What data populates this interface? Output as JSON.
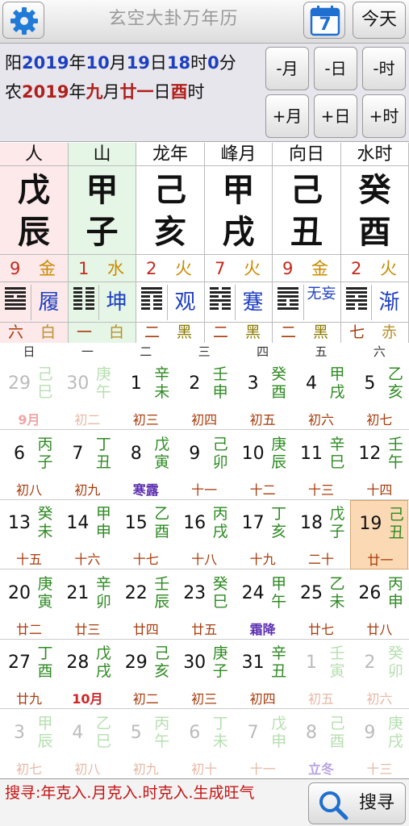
{
  "app": {
    "title": "玄空大卦万年历",
    "calendar_icon_day": "7",
    "today_label": "今天"
  },
  "date": {
    "solar_prefix": "阳",
    "solar_year": "2019",
    "year_char": "年",
    "solar_month": "10",
    "month_char": "月",
    "solar_day": "19",
    "day_char": "日",
    "solar_hour": "18",
    "hour_char": "时",
    "solar_min": "0",
    "min_char": "分",
    "lunar_prefix": "农",
    "lunar_year": "2019",
    "lunar_month": "九",
    "lunar_day": "廿一",
    "lunar_hour": "酉"
  },
  "nav": {
    "minus_month": "-月",
    "minus_day": "-日",
    "minus_hour": "-时",
    "plus_month": "+月",
    "plus_day": "+日",
    "plus_hour": "+时"
  },
  "pillars": [
    {
      "head": "人",
      "stem": "戊",
      "branch": "辰",
      "num": "9",
      "elem": "金",
      "elem_color": "#c98a00",
      "hex": "履",
      "hex_lines": [
        1,
        1,
        0,
        1,
        1,
        1
      ],
      "star_num": "六",
      "star": "白",
      "star_color": "#b8902a",
      "bg": "#fde8ea"
    },
    {
      "head": "山",
      "stem": "甲",
      "branch": "子",
      "num": "1",
      "elem": "水",
      "elem_color": "#c98a00",
      "hex": "坤",
      "hex_lines": [
        0,
        0,
        0,
        0,
        0,
        0
      ],
      "star_num": "一",
      "star": "白",
      "star_color": "#b8902a",
      "bg": "#e6f6e6"
    },
    {
      "head": "龙年",
      "stem": "己",
      "branch": "亥",
      "num": "2",
      "elem": "火",
      "elem_color": "#c98a00",
      "hex": "观",
      "hex_lines": [
        1,
        1,
        0,
        0,
        0,
        0
      ],
      "star_num": "二",
      "star": "黑",
      "star_color": "#8a7a00",
      "bg": "#fff"
    },
    {
      "head": "峰月",
      "stem": "甲",
      "branch": "戌",
      "num": "7",
      "elem": "火",
      "elem_color": "#c98a00",
      "hex": "蹇",
      "hex_lines": [
        0,
        1,
        0,
        1,
        0,
        0
      ],
      "star_num": "二",
      "star": "黑",
      "star_color": "#8a7a00",
      "bg": "#fff"
    },
    {
      "head": "向日",
      "stem": "己",
      "branch": "丑",
      "num": "9",
      "elem": "金",
      "elem_color": "#c98a00",
      "hex": "无妄",
      "hex_lines": [
        1,
        1,
        1,
        0,
        0,
        1
      ],
      "star_num": "二",
      "star": "黑",
      "star_color": "#8a7a00",
      "bg": "#fff"
    },
    {
      "head": "水时",
      "stem": "癸",
      "branch": "酉",
      "num": "2",
      "elem": "火",
      "elem_color": "#c98a00",
      "hex": "渐",
      "hex_lines": [
        1,
        1,
        0,
        1,
        0,
        0
      ],
      "star_num": "七",
      "star": "赤",
      "star_color": "#b8902a",
      "bg": "#fff"
    }
  ],
  "weekdays": [
    "日",
    "一",
    "二",
    "三",
    "四",
    "五",
    "六"
  ],
  "calendar": [
    [
      {
        "d": "29",
        "gz": [
          "己",
          "巳"
        ],
        "lu": "9月",
        "dim": true,
        "type": "month"
      },
      {
        "d": "30",
        "gz": [
          "庚",
          "午"
        ],
        "lu": "初二",
        "dim": true
      },
      {
        "d": "1",
        "gz": [
          "辛",
          "未"
        ],
        "lu": "初三"
      },
      {
        "d": "2",
        "gz": [
          "壬",
          "申"
        ],
        "lu": "初四"
      },
      {
        "d": "3",
        "gz": [
          "癸",
          "酉"
        ],
        "lu": "初五"
      },
      {
        "d": "4",
        "gz": [
          "甲",
          "戌"
        ],
        "lu": "初六"
      },
      {
        "d": "5",
        "gz": [
          "乙",
          "亥"
        ],
        "lu": "初七"
      }
    ],
    [
      {
        "d": "6",
        "gz": [
          "丙",
          "子"
        ],
        "lu": "初八"
      },
      {
        "d": "7",
        "gz": [
          "丁",
          "丑"
        ],
        "lu": "初九"
      },
      {
        "d": "8",
        "gz": [
          "戊",
          "寅"
        ],
        "lu": "寒露",
        "type": "term"
      },
      {
        "d": "9",
        "gz": [
          "己",
          "卯"
        ],
        "lu": "十一"
      },
      {
        "d": "10",
        "gz": [
          "庚",
          "辰"
        ],
        "lu": "十二"
      },
      {
        "d": "11",
        "gz": [
          "辛",
          "巳"
        ],
        "lu": "十三"
      },
      {
        "d": "12",
        "gz": [
          "壬",
          "午"
        ],
        "lu": "十四"
      }
    ],
    [
      {
        "d": "13",
        "gz": [
          "癸",
          "未"
        ],
        "lu": "十五"
      },
      {
        "d": "14",
        "gz": [
          "甲",
          "申"
        ],
        "lu": "十六"
      },
      {
        "d": "15",
        "gz": [
          "乙",
          "酉"
        ],
        "lu": "十七"
      },
      {
        "d": "16",
        "gz": [
          "丙",
          "戌"
        ],
        "lu": "十八"
      },
      {
        "d": "17",
        "gz": [
          "丁",
          "亥"
        ],
        "lu": "十九"
      },
      {
        "d": "18",
        "gz": [
          "戊",
          "子"
        ],
        "lu": "二十"
      },
      {
        "d": "19",
        "gz": [
          "己",
          "丑"
        ],
        "lu": "廿一",
        "sel": true
      }
    ],
    [
      {
        "d": "20",
        "gz": [
          "庚",
          "寅"
        ],
        "lu": "廿二"
      },
      {
        "d": "21",
        "gz": [
          "辛",
          "卯"
        ],
        "lu": "廿三"
      },
      {
        "d": "22",
        "gz": [
          "壬",
          "辰"
        ],
        "lu": "廿四"
      },
      {
        "d": "23",
        "gz": [
          "癸",
          "巳"
        ],
        "lu": "廿五"
      },
      {
        "d": "24",
        "gz": [
          "甲",
          "午"
        ],
        "lu": "霜降",
        "type": "term"
      },
      {
        "d": "25",
        "gz": [
          "乙",
          "未"
        ],
        "lu": "廿七"
      },
      {
        "d": "26",
        "gz": [
          "丙",
          "申"
        ],
        "lu": "廿八"
      }
    ],
    [
      {
        "d": "27",
        "gz": [
          "丁",
          "酉"
        ],
        "lu": "廿九"
      },
      {
        "d": "28",
        "gz": [
          "戊",
          "戌"
        ],
        "lu": "10月",
        "type": "month"
      },
      {
        "d": "29",
        "gz": [
          "己",
          "亥"
        ],
        "lu": "初二"
      },
      {
        "d": "30",
        "gz": [
          "庚",
          "子"
        ],
        "lu": "初三"
      },
      {
        "d": "31",
        "gz": [
          "辛",
          "丑"
        ],
        "lu": "初四"
      },
      {
        "d": "1",
        "gz": [
          "壬",
          "寅"
        ],
        "lu": "初五",
        "dim": true
      },
      {
        "d": "2",
        "gz": [
          "癸",
          "卯"
        ],
        "lu": "初六",
        "dim": true
      }
    ],
    [
      {
        "d": "3",
        "gz": [
          "甲",
          "辰"
        ],
        "lu": "初七",
        "dim": true
      },
      {
        "d": "4",
        "gz": [
          "乙",
          "巳"
        ],
        "lu": "初八",
        "dim": true
      },
      {
        "d": "5",
        "gz": [
          "丙",
          "午"
        ],
        "lu": "初九",
        "dim": true
      },
      {
        "d": "6",
        "gz": [
          "丁",
          "未"
        ],
        "lu": "初十",
        "dim": true
      },
      {
        "d": "7",
        "gz": [
          "戊",
          "申"
        ],
        "lu": "十一",
        "dim": true
      },
      {
        "d": "8",
        "gz": [
          "己",
          "酉"
        ],
        "lu": "立冬",
        "dim": true,
        "type": "term"
      },
      {
        "d": "9",
        "gz": [
          "庚",
          "戌"
        ],
        "lu": "十三",
        "dim": true
      }
    ]
  ],
  "bottom": {
    "query": "搜寻:年克入.月克入.时克入.生成旺气",
    "search_label": "搜寻"
  }
}
